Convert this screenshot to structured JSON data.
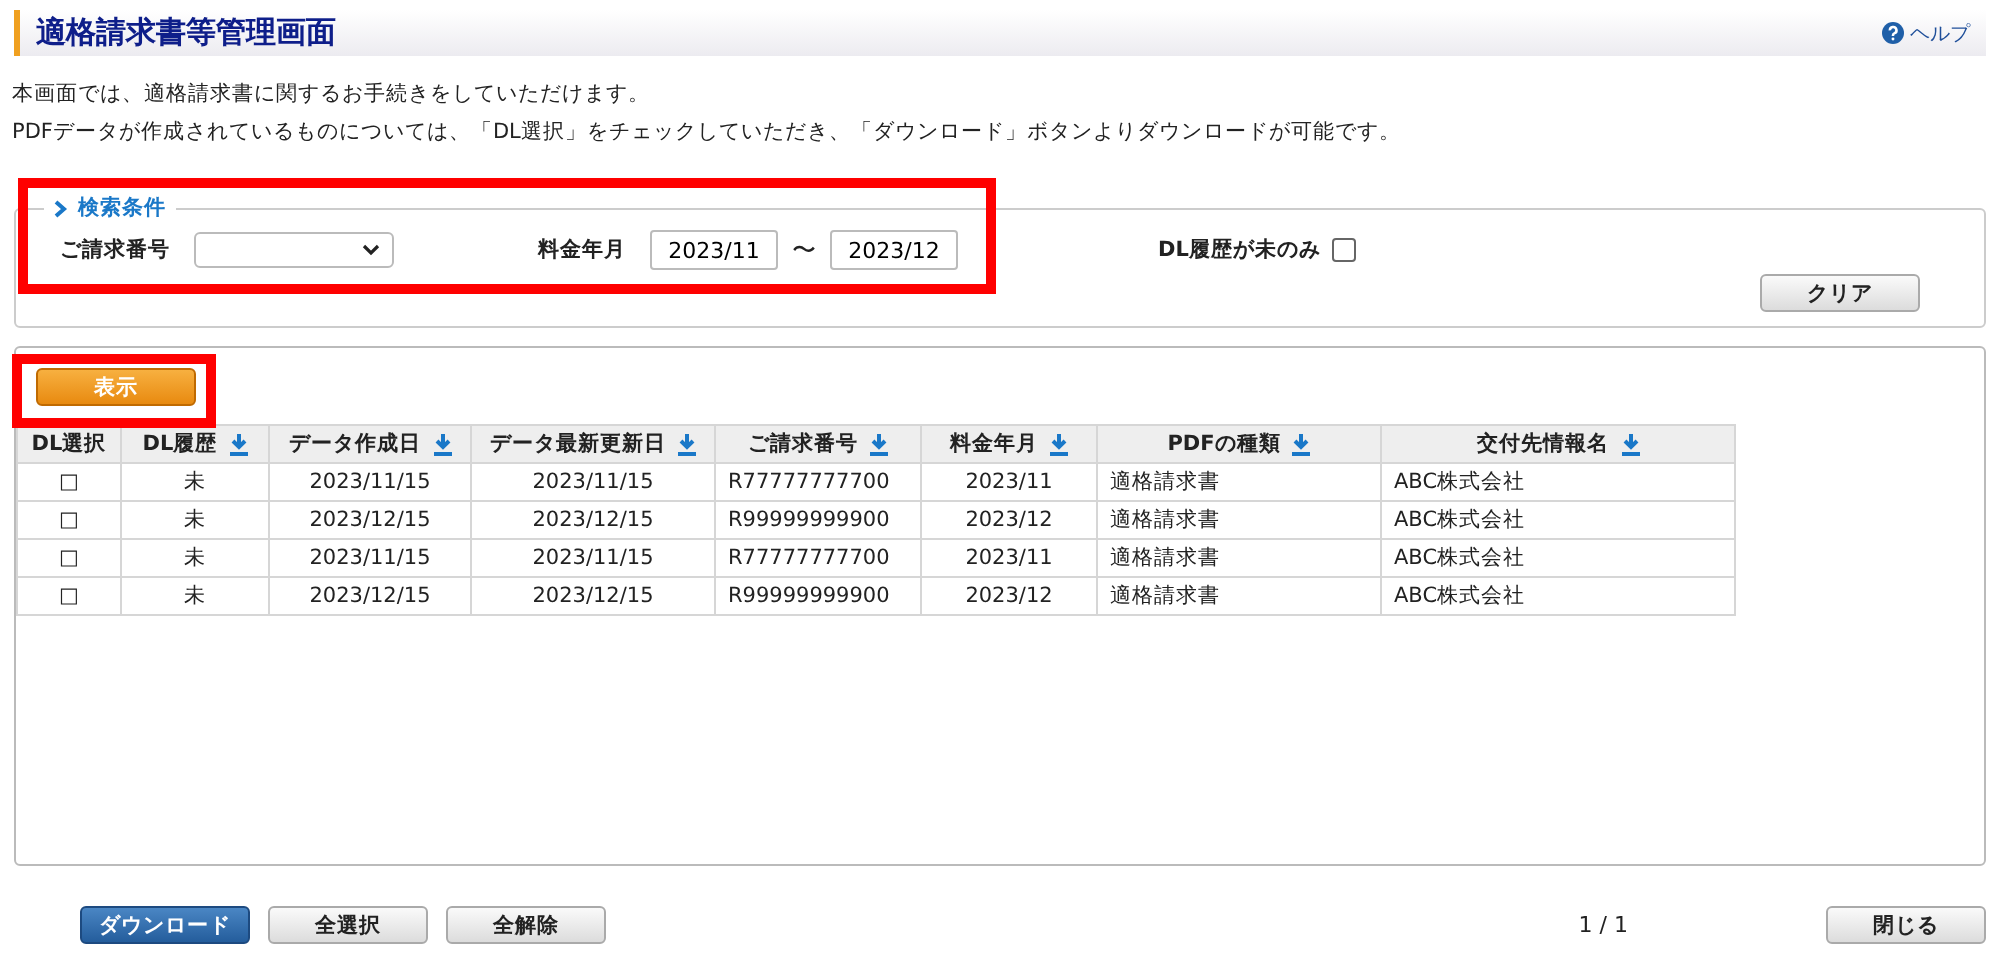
{
  "header": {
    "title": "適格請求書等管理画面",
    "help": "ヘルプ"
  },
  "description": [
    "本画面では、適格請求書に関するお手続きをしていただけます。",
    "PDFデータが作成されているものについては、「DL選択」をチェックしていただき、「ダウンロード」ボタンよりダウンロードが可能です。"
  ],
  "search": {
    "legend": "検索条件",
    "invoice_label": "ご請求番号",
    "period_label": "料金年月",
    "period_from": "2023/11",
    "period_separator": "〜",
    "period_to": "2023/12",
    "dl_filter_label": "DL履歴が未のみ",
    "dl_filter_checked": false,
    "clear_button": "クリア"
  },
  "show_button": "表示",
  "table": {
    "columns": [
      {
        "label": "DL選択",
        "sortable": false
      },
      {
        "label": "DL履歴",
        "sortable": true
      },
      {
        "label": "データ作成日",
        "sortable": true
      },
      {
        "label": "データ最新更新日",
        "sortable": true
      },
      {
        "label": "ご請求番号",
        "sortable": true
      },
      {
        "label": "料金年月",
        "sortable": true
      },
      {
        "label": "PDFの種類",
        "sortable": true
      },
      {
        "label": "交付先情報名",
        "sortable": true
      }
    ],
    "rows": [
      [
        "□",
        "未",
        "2023/11/15",
        "2023/11/15",
        "R77777777700",
        "2023/11",
        "適格請求書",
        "ABC株式会社"
      ],
      [
        "□",
        "未",
        "2023/12/15",
        "2023/12/15",
        "R99999999900",
        "2023/12",
        "適格請求書",
        "ABC株式会社"
      ],
      [
        "□",
        "未",
        "2023/11/15",
        "2023/11/15",
        "R77777777700",
        "2023/11",
        "適格請求書",
        "ABC株式会社"
      ],
      [
        "□",
        "未",
        "2023/12/15",
        "2023/12/15",
        "R99999999900",
        "2023/12",
        "適格請求書",
        "ABC株式会社"
      ]
    ]
  },
  "footer": {
    "buttons": [
      {
        "label": "ダウンロード",
        "kind": "primary"
      },
      {
        "label": "全選択",
        "kind": "secondary"
      },
      {
        "label": "全解除",
        "kind": "secondary"
      }
    ],
    "page": "1 / 1",
    "close_button": "閉じる"
  }
}
